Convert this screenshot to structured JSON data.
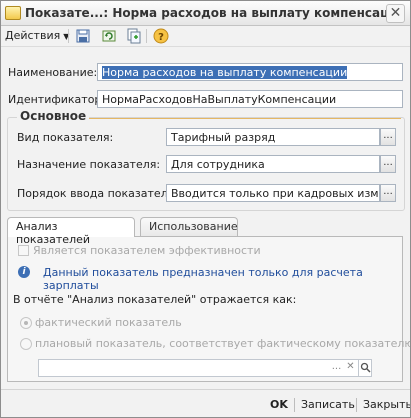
{
  "window": {
    "title": "Показате...: Норма расходов на выплату компенсации",
    "close_glyph": "✕"
  },
  "toolbar": {
    "actions_label": "Действия",
    "icons": [
      "save-write-icon",
      "reread-icon",
      "copy-icon",
      "help-icon"
    ]
  },
  "form": {
    "name_label": "Наименование:",
    "name_value": "Норма расходов на выплату компенсации",
    "identifier_label": "Идентификатор:",
    "identifier_value": "НормаРасходовНаВыплатуКомпенсации"
  },
  "main_group": {
    "title": "Основное",
    "rows": [
      {
        "label": "Вид показателя:",
        "value": "Тарифный разряд"
      },
      {
        "label": "Назначение показателя:",
        "value": "Для сотрудника"
      },
      {
        "label": "Порядок ввода показателя:",
        "value": "Вводится только при кадровых изменени"
      }
    ],
    "select_button_glyph": "..."
  },
  "tabs": [
    {
      "label": "Анализ показателей",
      "active": true
    },
    {
      "label": "Использование",
      "active": false
    }
  ],
  "analysis": {
    "efficiency_checkbox_label": "Является показателем эффективности",
    "info_text": "Данный показатель предназначен только для расчета зарплаты",
    "report_caption": "В отчёте \"Анализ показателей\" отражается как:",
    "radio_actual": "фактический показатель",
    "radio_planned": "плановый показатель, соответствует фактическому показателю:",
    "combo_value": "",
    "combo_buttons": [
      "...",
      "✕",
      "🔍"
    ]
  },
  "bottom": {
    "ok_label": "OK",
    "write_label": "Записать",
    "close_label": "Закрыть"
  },
  "colors": {
    "selection": "#3d6fb5",
    "group_line": "#e5b764",
    "info_text": "#1f4c9b"
  }
}
